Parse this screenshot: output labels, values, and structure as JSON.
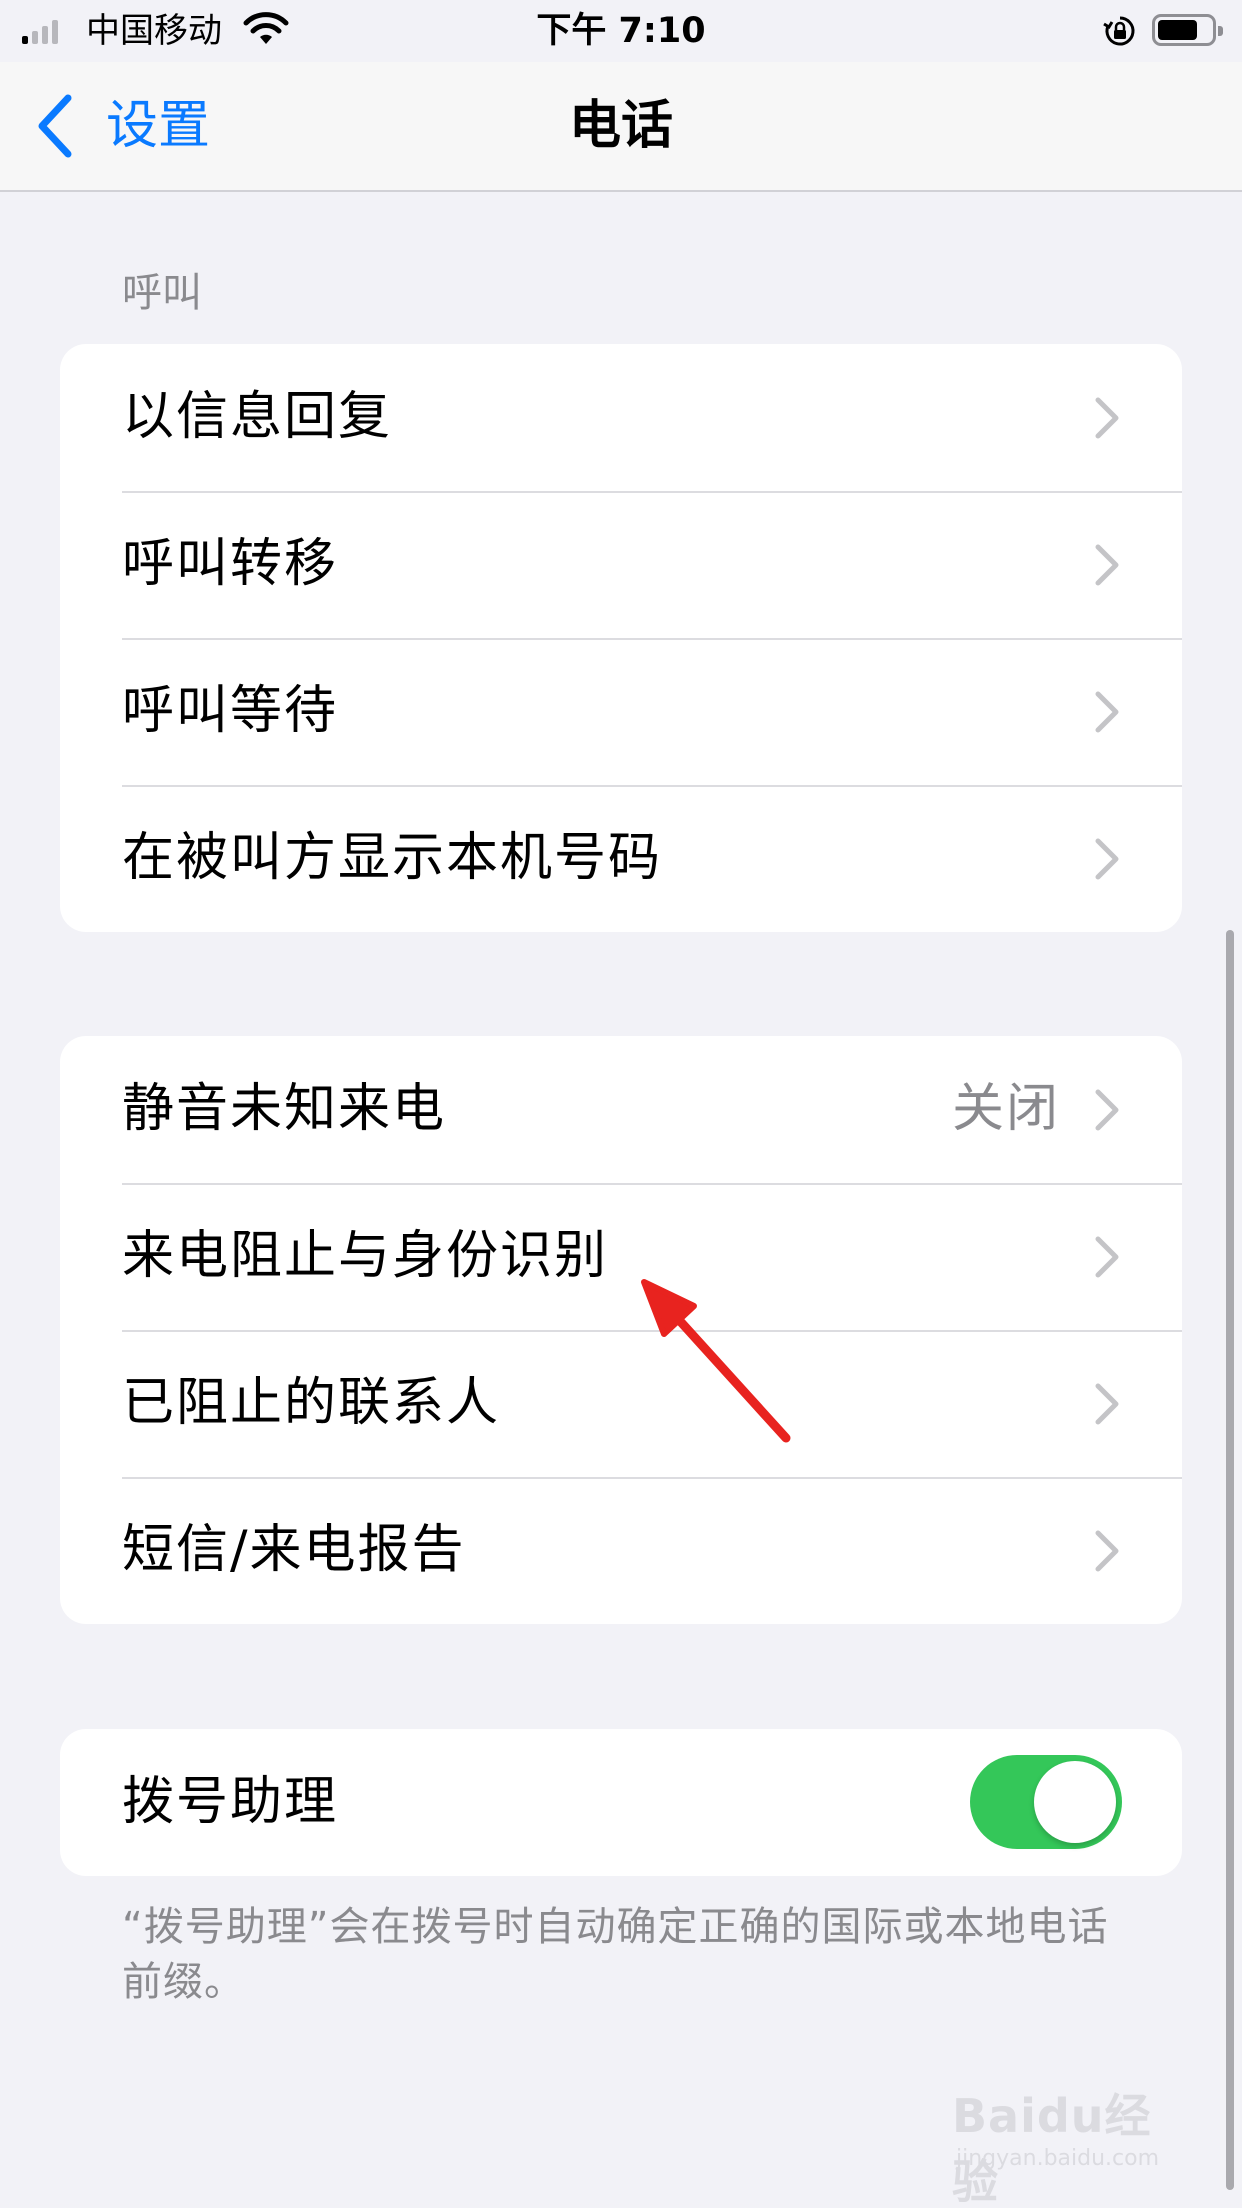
{
  "status_bar": {
    "carrier": "中国移动",
    "time": "下午 7:10",
    "battery_level": 0.75
  },
  "nav": {
    "back_label": "设置",
    "title": "电话"
  },
  "sections": {
    "calls_header": "呼叫",
    "calls_items": [
      {
        "label": "以信息回复"
      },
      {
        "label": "呼叫转移"
      },
      {
        "label": "呼叫等待"
      },
      {
        "label": "在被叫方显示本机号码"
      }
    ],
    "blocking_items": [
      {
        "label": "静音未知来电",
        "value": "关闭"
      },
      {
        "label": "来电阻止与身份识别"
      },
      {
        "label": "已阻止的联系人"
      },
      {
        "label": "短信/来电报告"
      }
    ],
    "dial_assist": {
      "label": "拨号助理",
      "enabled": true,
      "footer": "“拨号助理”会在拨号时自动确定正确的国际或本地电话前缀。"
    }
  },
  "colors": {
    "accent": "#0a7aff",
    "toggle_on": "#34c759",
    "annotation": "#e8231f"
  },
  "watermark": {
    "logo": "Baidu经验",
    "url": "jingyan.baidu.com"
  }
}
